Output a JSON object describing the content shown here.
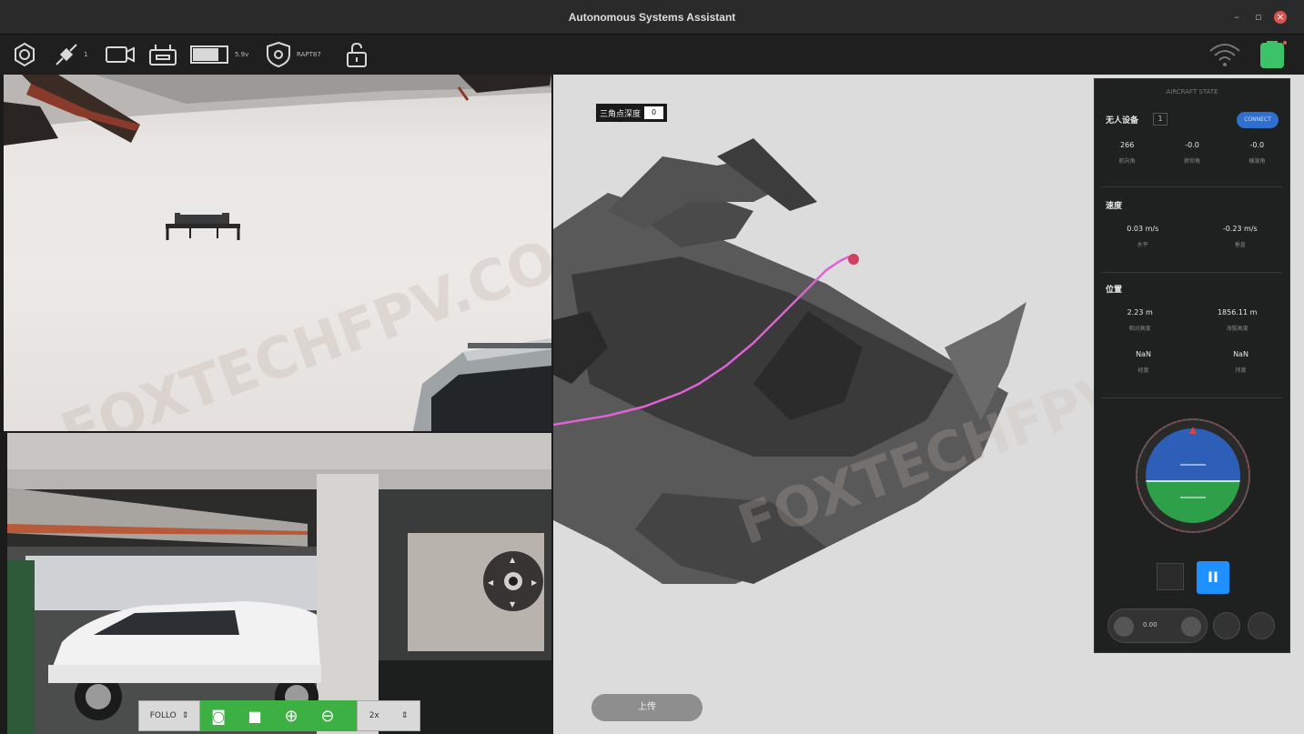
{
  "window": {
    "title": "Autonomous Systems Assistant",
    "controls": [
      "minimize",
      "maximize",
      "close"
    ]
  },
  "toolbar": {
    "gps_count": "1",
    "battery_text": "5.9v",
    "mode_text": "RAPT87",
    "icons": [
      "settings-icon",
      "satellite-icon",
      "camera-icon",
      "remote-icon",
      "battery-icon",
      "shield-gear-icon",
      "unlock-icon",
      "wifi-icon",
      "device-battery-icon"
    ]
  },
  "map": {
    "tag_label": "三角点深度",
    "tag_value": "0",
    "upload_label": "上传",
    "trajectory_color": "#e060d8"
  },
  "panel": {
    "header": "AIRCRAFT STATE",
    "device": {
      "label": "无人设备",
      "value": "1",
      "button": "CONNECT"
    },
    "attitude": [
      {
        "value": "266",
        "unit": "航向角"
      },
      {
        "value": "-0.0",
        "unit": "俯仰角"
      },
      {
        "value": "-0.0",
        "unit": "横滚角"
      }
    ],
    "speed": {
      "title": "速度",
      "items": [
        {
          "value": "0.03 m/s",
          "unit": "水平"
        },
        {
          "value": "-0.23 m/s",
          "unit": "垂直"
        }
      ]
    },
    "position": {
      "title": "位置",
      "items": [
        {
          "value": "2.23 m",
          "unit": "相对高度"
        },
        {
          "value": "1856.11 m",
          "unit": "海拔高度"
        },
        {
          "value": "NaN",
          "unit": "经度"
        },
        {
          "value": "NaN",
          "unit": "纬度"
        }
      ]
    },
    "horizon": {
      "sky_color": "#2d5fb8",
      "ground_color": "#2fa04a"
    },
    "speed_readout": "0.00"
  },
  "controls_bar": {
    "mode": "FOLLO",
    "zoom": "2x"
  },
  "watermark": "FOXTECHFPV.COM"
}
